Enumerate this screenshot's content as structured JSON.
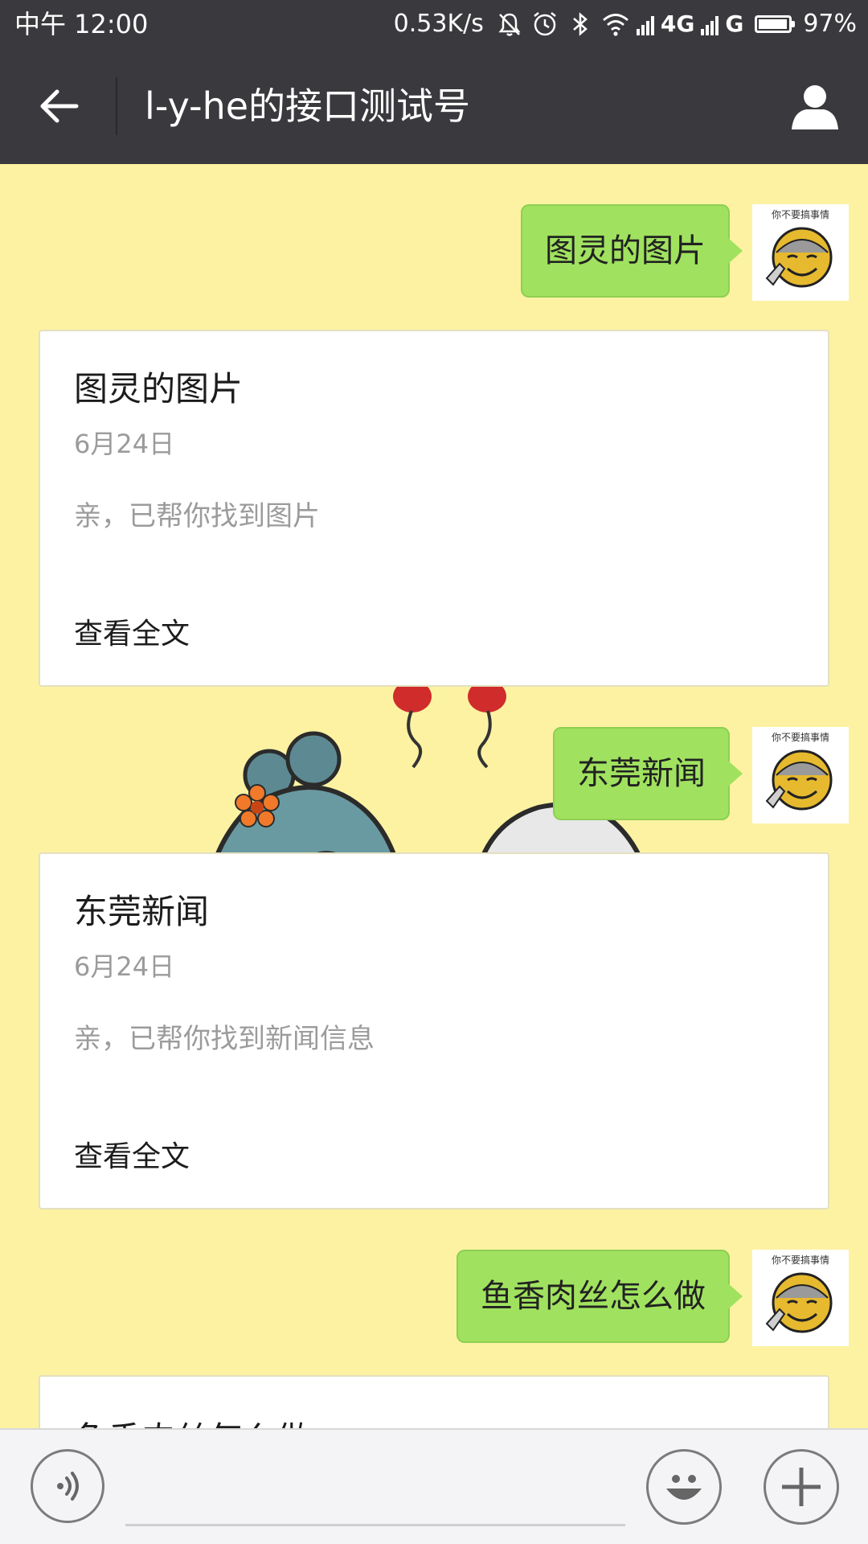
{
  "status_bar": {
    "time": "中午 12:00",
    "net_speed": "0.53K/s",
    "network_1": "4G",
    "network_2": "G",
    "battery_percent_text": "97%",
    "battery_level": 0.97,
    "icons": [
      "mute-icon",
      "alarm-icon",
      "bluetooth-icon",
      "wifi-icon",
      "signal-icon",
      "battery-icon"
    ]
  },
  "header": {
    "title": "l-y-he的接口测试号",
    "back_icon": "back-arrow-icon",
    "profile_icon": "profile-icon"
  },
  "chat": {
    "background_color": "#fcf2a2",
    "bubble_color": "#a0e25f",
    "avatar_caption": "你不要搞事情",
    "messages": [
      {
        "type": "sent",
        "text": "图灵的图片"
      },
      {
        "type": "card",
        "title": "图灵的图片",
        "date": "6月24日",
        "description": "亲，已帮你找到图片",
        "link": "查看全文"
      },
      {
        "type": "sent",
        "text": "东莞新闻"
      },
      {
        "type": "card",
        "title": "东莞新闻",
        "date": "6月24日",
        "description": "亲，已帮你找到新闻信息",
        "link": "查看全文"
      },
      {
        "type": "sent",
        "text": "鱼香肉丝怎么做"
      },
      {
        "type": "card",
        "title": "鱼香肉丝怎么做"
      }
    ]
  },
  "input_bar": {
    "voice_icon": "voice-icon",
    "emoji_icon": "emoji-icon",
    "plus_icon": "plus-icon",
    "placeholder": ""
  }
}
